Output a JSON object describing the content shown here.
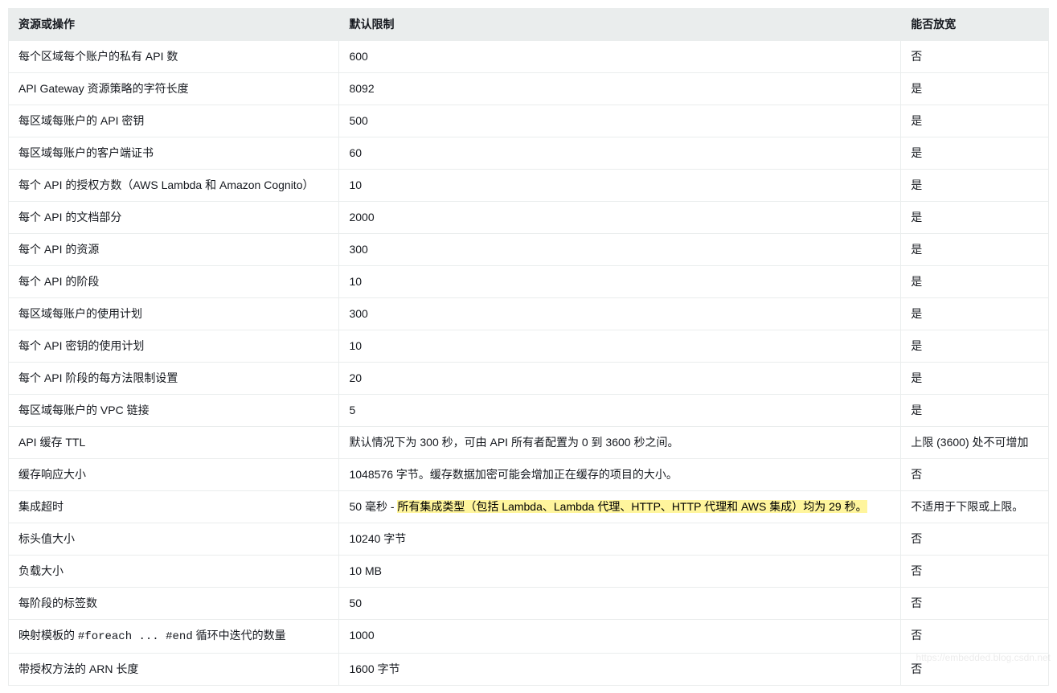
{
  "table": {
    "headers": {
      "resource": "资源或操作",
      "limit": "默认限制",
      "relax": "能否放宽"
    },
    "rows": [
      {
        "resource": "每个区域每个账户的私有 API 数",
        "limit": "600",
        "relax": "否"
      },
      {
        "resource": "API Gateway 资源策略的字符长度",
        "limit": "8092",
        "relax": "是"
      },
      {
        "resource": "每区域每账户的 API 密钥",
        "limit": "500",
        "relax": "是"
      },
      {
        "resource": "每区域每账户的客户端证书",
        "limit": "60",
        "relax": "是"
      },
      {
        "resource": "每个 API 的授权方数（AWS Lambda 和 Amazon Cognito）",
        "limit": "10",
        "relax": "是"
      },
      {
        "resource": "每个 API 的文档部分",
        "limit": "2000",
        "relax": "是"
      },
      {
        "resource": "每个 API 的资源",
        "limit": "300",
        "relax": "是"
      },
      {
        "resource": "每个 API 的阶段",
        "limit": "10",
        "relax": "是"
      },
      {
        "resource": "每区域每账户的使用计划",
        "limit": "300",
        "relax": "是"
      },
      {
        "resource": "每个 API 密钥的使用计划",
        "limit": "10",
        "relax": "是"
      },
      {
        "resource": "每个 API 阶段的每方法限制设置",
        "limit": "20",
        "relax": "是"
      },
      {
        "resource": "每区域每账户的 VPC 链接",
        "limit": "5",
        "relax": "是"
      },
      {
        "resource": "API 缓存 TTL",
        "limit": "默认情况下为 300 秒，可由 API 所有者配置为 0 到 3600 秒之间。",
        "relax": "上限 (3600) 处不可增加"
      },
      {
        "resource": "缓存响应大小",
        "limit": "1048576 字节。缓存数据加密可能会增加正在缓存的项目的大小。",
        "relax": "否"
      },
      {
        "resource": "集成超时",
        "limit_prefix": "50 毫秒 - ",
        "limit_highlight": "所有集成类型（包括 Lambda、Lambda 代理、HTTP、HTTP 代理和 AWS 集成）均为 29 秒。",
        "relax": "不适用于下限或上限。"
      },
      {
        "resource": "标头值大小",
        "limit": "10240 字节",
        "relax": "否"
      },
      {
        "resource": "负载大小",
        "limit": "10 MB",
        "relax": "否"
      },
      {
        "resource": "每阶段的标签数",
        "limit": "50",
        "relax": "否"
      },
      {
        "resource_prefix": "映射模板的 ",
        "resource_code": "#foreach ... #end",
        "resource_suffix": " 循环中迭代的数量",
        "limit": "1000",
        "relax": "否"
      },
      {
        "resource": "带授权方法的 ARN 长度",
        "limit": "1600 字节",
        "relax": "否"
      }
    ]
  },
  "watermark": "https://embedded.blog.csdn.net"
}
